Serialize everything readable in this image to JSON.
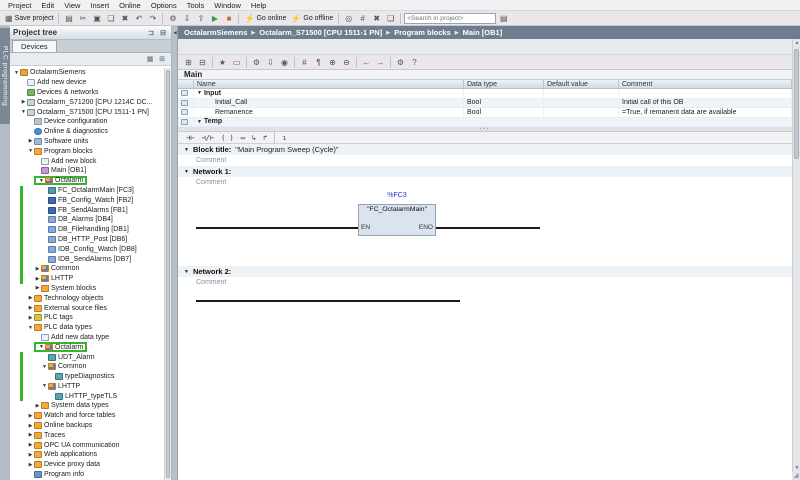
{
  "colors": {
    "highlight_green": "#35b52b",
    "breadcrumb_bg": "#6e7d8d",
    "block_fill": "#dae3ee",
    "address_blue": "#2929cf",
    "go_online_orange": "#e08a1a"
  },
  "menubar": {
    "items": [
      "Project",
      "Edit",
      "View",
      "Insert",
      "Online",
      "Options",
      "Tools",
      "Window",
      "Help"
    ]
  },
  "toolbar": {
    "items": [
      {
        "name": "save-project-button",
        "icon": "save-icon",
        "glyph": "▦",
        "label": "Save project"
      },
      {
        "sep": true
      },
      {
        "name": "print-button",
        "icon": "print-icon",
        "glyph": "▤"
      },
      {
        "name": "cut-button",
        "icon": "cut-icon",
        "glyph": "✂"
      },
      {
        "name": "copy-button",
        "icon": "copy-icon",
        "glyph": "▣"
      },
      {
        "name": "paste-button",
        "icon": "paste-icon",
        "glyph": "❏"
      },
      {
        "name": "delete-button",
        "icon": "delete-icon",
        "glyph": "✖"
      },
      {
        "name": "undo-button",
        "icon": "undo-icon",
        "glyph": "↶"
      },
      {
        "name": "redo-button",
        "icon": "redo-icon",
        "glyph": "↷"
      },
      {
        "sep": true
      },
      {
        "name": "compile-button",
        "icon": "compile-icon",
        "glyph": "⚙"
      },
      {
        "name": "download-button",
        "icon": "download-icon",
        "glyph": "⇩"
      },
      {
        "name": "upload-button",
        "icon": "upload-icon",
        "glyph": "⇧"
      },
      {
        "name": "start-cpu-button",
        "icon": "start-cpu-icon",
        "glyph": "▶",
        "color": "#3a9c3a"
      },
      {
        "name": "stop-cpu-button",
        "icon": "stop-cpu-icon",
        "glyph": "■",
        "color": "#c2762a"
      },
      {
        "sep": true
      },
      {
        "name": "go-online-button",
        "icon": "go-online-icon",
        "glyph": "⚡",
        "label": "Go online",
        "color": "#e08a1a"
      },
      {
        "name": "go-offline-button",
        "icon": "go-offline-icon",
        "glyph": "⚡",
        "label": "Go offline",
        "color": "#6a7685"
      },
      {
        "sep": true
      },
      {
        "name": "online-diagnostics-button",
        "icon": "diagnostics-icon",
        "glyph": "◎"
      },
      {
        "name": "simulation-button",
        "icon": "simulation-icon",
        "glyph": "#"
      },
      {
        "name": "remove-button",
        "icon": "cross-icon",
        "glyph": "✖"
      },
      {
        "name": "split-window-button",
        "icon": "window-icon",
        "glyph": "❏"
      },
      {
        "sep": true
      },
      {
        "search": true,
        "placeholder": "<Search in project>"
      },
      {
        "name": "assistant-button",
        "icon": "assistant-icon",
        "glyph": "▤"
      }
    ]
  },
  "breadcrumb": {
    "items": [
      "OctalarmSiemens",
      "Octalarm_S71500 [CPU 1511-1 PN]",
      "Program blocks",
      "Main [OB1]"
    ]
  },
  "side_strip": {
    "label": "PLC programming"
  },
  "project_tree": {
    "title": "Project tree",
    "tab": "Devices",
    "items": [
      {
        "label": "OctalarmSiemens",
        "level": 0,
        "icon": "project",
        "exp": "open"
      },
      {
        "label": "Add new device",
        "level": 1,
        "icon": "add-device"
      },
      {
        "label": "Devices & networks",
        "level": 1,
        "icon": "devices-networks"
      },
      {
        "label": "Octalarm_S71200 [CPU 1214C DC...",
        "level": 1,
        "icon": "plc-device",
        "exp": "closed"
      },
      {
        "label": "Octalarm_S71500 [CPU 1511-1 PN]",
        "level": 1,
        "icon": "plc-device",
        "exp": "open"
      },
      {
        "label": "Device configuration",
        "level": 2,
        "icon": "device-config"
      },
      {
        "label": "Online & diagnostics",
        "level": 2,
        "icon": "online-diagnostics"
      },
      {
        "label": "Software units",
        "level": 2,
        "icon": "software-units",
        "exp": "closed"
      },
      {
        "label": "Program blocks",
        "level": 2,
        "icon": "folder",
        "exp": "open"
      },
      {
        "label": "Add new block",
        "level": 3,
        "icon": "add-block"
      },
      {
        "label": "Main [OB1]",
        "level": 3,
        "icon": "ob-block"
      },
      {
        "label": "Octalarm",
        "level": 3,
        "icon": "block-folder",
        "exp": "open",
        "highlight": true
      },
      {
        "label": "FC_OctalarmMain [FC3]",
        "level": 4,
        "icon": "fc-block",
        "bar": true
      },
      {
        "label": "FB_Config_Watch [FB2]",
        "level": 4,
        "icon": "fb-block",
        "bar": true
      },
      {
        "label": "FB_SendAlarms [FB1]",
        "level": 4,
        "icon": "fb-block",
        "bar": true
      },
      {
        "label": "DB_Alarms [DB4]",
        "level": 4,
        "icon": "db-block",
        "bar": true
      },
      {
        "label": "DB_Filehandling [DB1]",
        "level": 4,
        "icon": "db-block",
        "bar": true
      },
      {
        "label": "DB_HTTP_Post [DB6]",
        "level": 4,
        "icon": "db-block",
        "bar": true
      },
      {
        "label": "IDB_Config_Watch [DB8]",
        "level": 4,
        "icon": "db-block",
        "bar": true
      },
      {
        "label": "IDB_SendAlarms [DB7]",
        "level": 4,
        "icon": "db-block",
        "bar": true
      },
      {
        "label": "Common",
        "level": 3,
        "icon": "block-folder",
        "exp": "closed",
        "bar": true
      },
      {
        "label": "LHTTP",
        "level": 3,
        "icon": "block-folder",
        "exp": "closed",
        "bar": true
      },
      {
        "label": "System blocks",
        "level": 3,
        "icon": "system-folder",
        "exp": "closed"
      },
      {
        "label": "Technology objects",
        "level": 2,
        "icon": "folder",
        "exp": "closed"
      },
      {
        "label": "External source files",
        "level": 2,
        "icon": "folder",
        "exp": "closed"
      },
      {
        "label": "PLC tags",
        "level": 2,
        "icon": "plc-tags",
        "exp": "closed"
      },
      {
        "label": "PLC data types",
        "level": 2,
        "icon": "plc-data-types",
        "exp": "open"
      },
      {
        "label": "Add new data type",
        "level": 3,
        "icon": "add-block"
      },
      {
        "label": "Octalarm",
        "level": 3,
        "icon": "block-folder",
        "exp": "open",
        "highlight": true
      },
      {
        "label": "UDT_Alarm",
        "level": 4,
        "icon": "udt",
        "bar": true
      },
      {
        "label": "Common",
        "level": 4,
        "icon": "block-folder",
        "exp": "open",
        "bar": true
      },
      {
        "label": "typeDiagnostics",
        "level": 5,
        "icon": "udt",
        "bar": true
      },
      {
        "label": "LHTTP",
        "level": 4,
        "icon": "block-folder",
        "exp": "open",
        "bar": true
      },
      {
        "label": "LHTTP_typeTLS",
        "level": 5,
        "icon": "udt",
        "bar": true
      },
      {
        "label": "System data types",
        "level": 3,
        "icon": "system-folder",
        "exp": "closed"
      },
      {
        "label": "Watch and force tables",
        "level": 2,
        "icon": "folder",
        "exp": "closed"
      },
      {
        "label": "Online backups",
        "level": 2,
        "icon": "folder",
        "exp": "closed"
      },
      {
        "label": "Traces",
        "level": 2,
        "icon": "folder",
        "exp": "closed"
      },
      {
        "label": "OPC UA communication",
        "level": 2,
        "icon": "folder",
        "exp": "closed"
      },
      {
        "label": "Web applications",
        "level": 2,
        "icon": "folder",
        "exp": "closed"
      },
      {
        "label": "Device proxy data",
        "level": 2,
        "icon": "folder",
        "exp": "closed"
      },
      {
        "label": "Program info",
        "level": 2,
        "icon": "program-info"
      }
    ]
  },
  "editor": {
    "section_label": "Main",
    "toolbar_icons": [
      {
        "name": "insert-network-icon",
        "glyph": "⊞"
      },
      {
        "name": "delete-network-icon",
        "glyph": "⊟"
      },
      {
        "sep": true
      },
      {
        "name": "favorites-icon",
        "glyph": "★"
      },
      {
        "name": "empty-box-tool-icon",
        "glyph": "▭"
      },
      {
        "sep": true
      },
      {
        "name": "compile-block-icon",
        "glyph": "⚙"
      },
      {
        "name": "download-block-icon",
        "glyph": "⇩"
      },
      {
        "name": "monitoring-icon",
        "glyph": "◉"
      },
      {
        "sep": true
      },
      {
        "name": "absolute-operands-icon",
        "glyph": "#"
      },
      {
        "name": "network-comments-icon",
        "glyph": "¶"
      },
      {
        "name": "expand-networks-icon",
        "glyph": "⊕"
      },
      {
        "name": "collapse-networks-icon",
        "glyph": "⊖"
      },
      {
        "sep": true
      },
      {
        "name": "previous-icon",
        "glyph": "←"
      },
      {
        "name": "next-icon",
        "glyph": "→"
      },
      {
        "sep": true
      },
      {
        "name": "settings-icon",
        "glyph": "⚙"
      },
      {
        "name": "help-icon",
        "glyph": "?"
      }
    ],
    "ladder_tools": [
      {
        "name": "no-contact-icon",
        "glyph": "⊣⊢"
      },
      {
        "name": "nc-contact-icon",
        "glyph": "⊣/⊢"
      },
      {
        "name": "coil-icon",
        "glyph": "( )"
      },
      {
        "name": "empty-box-icon",
        "glyph": "▭"
      },
      {
        "name": "open-branch-icon",
        "glyph": "↳"
      },
      {
        "name": "close-branch-icon",
        "glyph": "↱"
      },
      {
        "sep": true
      },
      {
        "name": "insert-row-icon",
        "glyph": "↴"
      }
    ],
    "interface_table": {
      "columns": [
        "Name",
        "Data type",
        "Default value",
        "Comment"
      ],
      "rows": [
        {
          "name": "Input",
          "datatype": "",
          "default": "",
          "comment": "",
          "kind": "section"
        },
        {
          "name": "Initial_Call",
          "datatype": "Bool",
          "default": "",
          "comment": "Initial call of this OB",
          "kind": "var"
        },
        {
          "name": "Remanence",
          "datatype": "Bool",
          "default": "",
          "comment": "=True, if remanent data are available",
          "kind": "var"
        },
        {
          "name": "Temp",
          "datatype": "",
          "default": "",
          "comment": "",
          "kind": "section"
        }
      ]
    },
    "block_title_label": "Block title:",
    "block_title_value": "\"Main Program Sweep (Cycle)\"",
    "comment_placeholder": "Comment",
    "networks": [
      {
        "label": "Network 1:",
        "comment": "Comment",
        "call": {
          "address": "%FC3",
          "name": "\"FC_OctalarmMain\"",
          "en": "EN",
          "eno": "ENO"
        }
      },
      {
        "label": "Network 2:",
        "comment": "Comment"
      }
    ]
  }
}
